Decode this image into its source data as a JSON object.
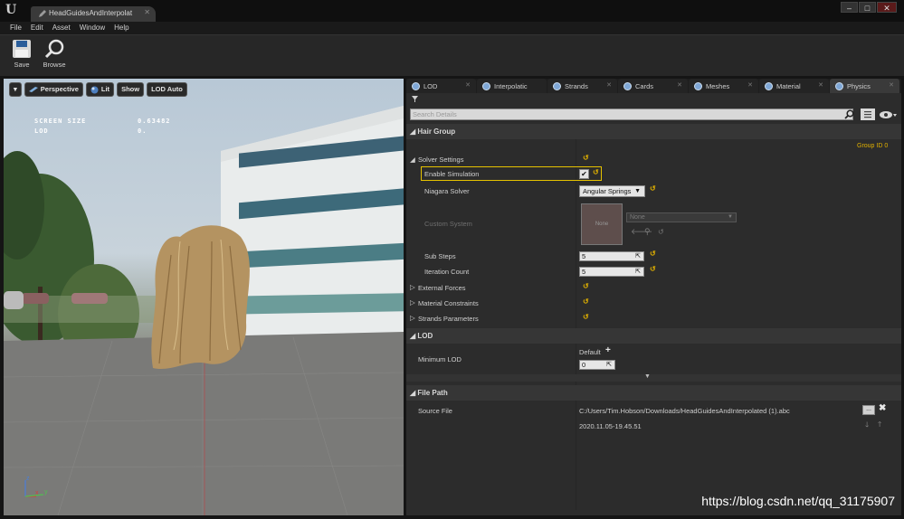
{
  "window": {
    "tab_title": "HeadGuidesAndInterpolat",
    "min": "–",
    "max": "□",
    "close": "✕"
  },
  "menu": [
    "File",
    "Edit",
    "Asset",
    "Window",
    "Help"
  ],
  "toolbar": {
    "save_label": "Save",
    "browse_label": "Browse"
  },
  "viewport": {
    "menu_arrow": "▾",
    "perspective_label": "Perspective",
    "lit_label": "Lit",
    "show_label": "Show",
    "lod_auto_label": "LOD Auto",
    "stats": [
      {
        "label": "SCREEN SIZE",
        "value": "0.63482"
      },
      {
        "label": "LOD",
        "value": "0."
      }
    ],
    "axis": {
      "z": "z",
      "x": "x",
      "y": "y"
    }
  },
  "details": {
    "tabs": [
      "LOD",
      "Interpolatic",
      "Strands",
      "Cards",
      "Meshes",
      "Material",
      "Physics"
    ],
    "active_tab": "Physics",
    "search_placeholder": "Search Details",
    "hair_group": {
      "header": "Hair Group",
      "group_id": "Group ID 0",
      "solver_settings": "Solver Settings",
      "enable_simulation": "Enable Simulation",
      "enable_simulation_checked": true,
      "niagara_solver_label": "Niagara Solver",
      "niagara_solver_value": "Angular Springs",
      "custom_system_label": "Custom System",
      "custom_system_thumb": "None",
      "custom_system_value": "None",
      "sub_steps_label": "Sub Steps",
      "sub_steps_value": "5",
      "iteration_count_label": "Iteration Count",
      "iteration_count_value": "5",
      "external_forces": "External Forces",
      "material_constraints": "Material Constraints",
      "strands_parameters": "Strands Parameters"
    },
    "lod": {
      "header": "LOD",
      "minimum_lod_label": "Minimum LOD",
      "default_label": "Default",
      "minimum_lod_value": "0"
    },
    "file_path": {
      "header": "File Path",
      "source_file_label": "Source File",
      "source_file_value": "C:/Users/Tim.Hobson/Downloads/HeadGuidesAndInterpolated (1).abc",
      "timestamp": "2020.11.05-19.45.51"
    }
  },
  "watermark": "https://blog.csdn.net/qq_31175907",
  "colors": {
    "accent": "#e0b000",
    "highlight_border": "#e6c200",
    "panel": "#2c2c2c"
  }
}
